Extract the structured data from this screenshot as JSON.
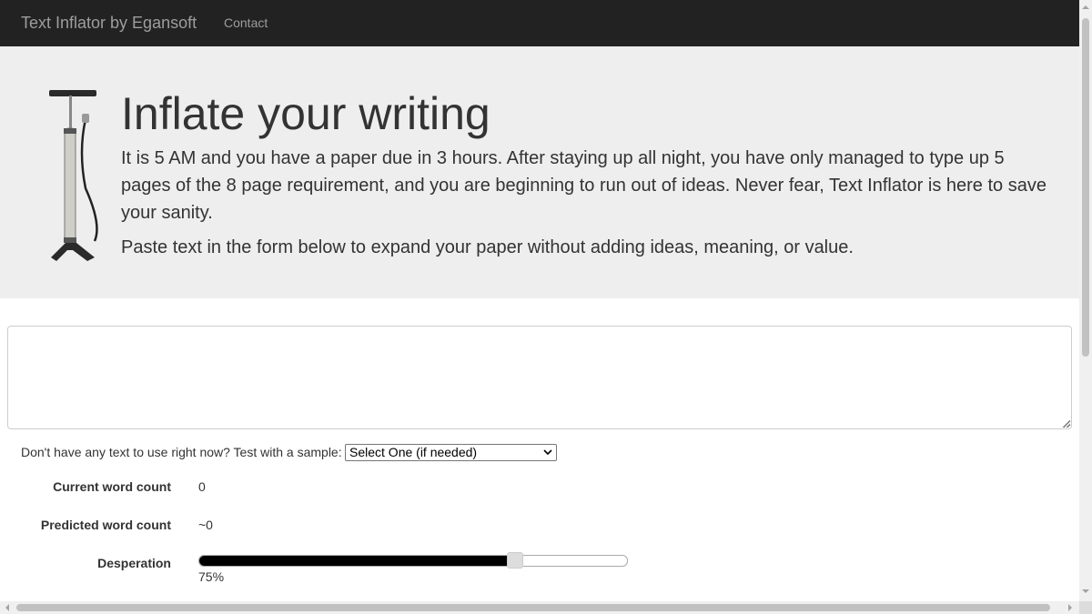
{
  "navbar": {
    "brand": "Text Inflator by Egansoft",
    "links": [
      {
        "label": "Contact"
      }
    ]
  },
  "hero": {
    "image_icon": "bicycle-pump-icon",
    "title": "Inflate your writing",
    "intro": "It is 5 AM and you have a paper due in 3 hours. After staying up all night, you have only managed to type up 5 pages of the 8 page requirement, and you are beginning to run out of ideas. Never fear, Text Inflator is here to save your sanity.",
    "instruction": "Paste text in the form below to expand your paper without adding ideas, meaning, or value."
  },
  "form": {
    "text_value": "",
    "sample_prompt": "Don't have any text to use right now? Test with a sample:",
    "sample_select": {
      "selected": "Select One (if needed)",
      "icon": "chevron-down-icon"
    },
    "current_word_count": {
      "label": "Current word count",
      "value": "0"
    },
    "predicted_word_count": {
      "label": "Predicted word count",
      "value": "~0"
    },
    "desperation": {
      "label": "Desperation",
      "value_percent": 75,
      "display": "75%"
    }
  },
  "colors": {
    "navbar_bg": "#222222",
    "navbar_text": "#9d9d9d",
    "hero_bg": "#eeeeee",
    "slider_fill": "#000000"
  }
}
